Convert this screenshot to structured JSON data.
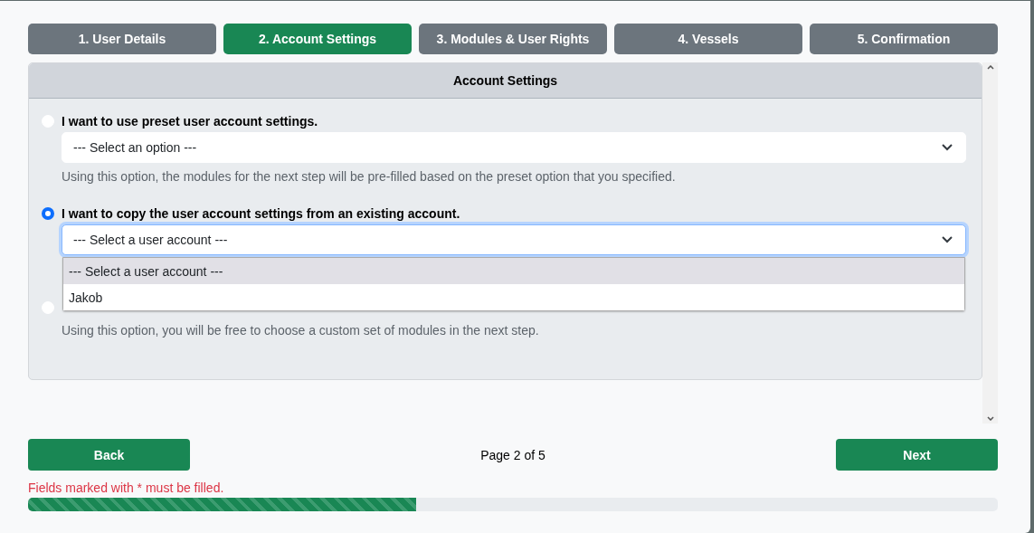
{
  "steps": [
    {
      "label": "1. User Details",
      "selected": false
    },
    {
      "label": "2. Account Settings",
      "selected": true
    },
    {
      "label": "3. Modules & User Rights",
      "selected": false
    },
    {
      "label": "4. Vessels",
      "selected": false
    },
    {
      "label": "5. Confirmation",
      "selected": false
    }
  ],
  "panel": {
    "title": "Account Settings",
    "options": [
      {
        "selected": false,
        "label": "I want to use preset user account settings.",
        "select": {
          "value": "--- Select an option ---",
          "focused": false
        },
        "help": "Using this option, the modules for the next step will be pre-filled based on the preset option that you specified."
      },
      {
        "selected": true,
        "label": "I want to copy the user account settings from an existing account.",
        "select": {
          "value": "--- Select a user account ---",
          "focused": true,
          "menu": [
            {
              "label": "--- Select a user account ---",
              "selected": true
            },
            {
              "label": "Jakob",
              "selected": false
            }
          ]
        }
      },
      {
        "selected": false,
        "help": "Using this option, you will be free to choose a custom set of modules in the next step."
      }
    ]
  },
  "footer": {
    "back": "Back",
    "page": "Page 2 of 5",
    "next": "Next",
    "note": "Fields marked with * must be filled.",
    "progress": {
      "level": 0.4
    }
  }
}
